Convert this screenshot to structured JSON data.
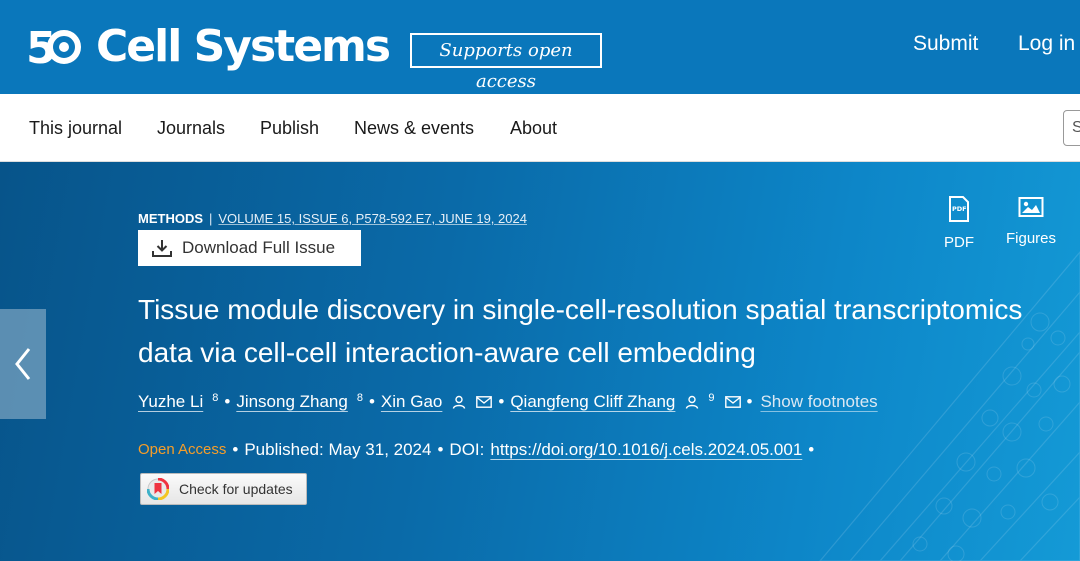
{
  "header": {
    "logo_text": "Cell Systems",
    "badge": "Supports open access",
    "submit_label": "Submit",
    "login_label": "Log in"
  },
  "nav": {
    "items": [
      "This journal",
      "Journals",
      "Publish",
      "News & events",
      "About"
    ],
    "search_placeholder": "S"
  },
  "article": {
    "type": "METHODS",
    "citation": "VOLUME 15, ISSUE 6, P578-592.E7, JUNE 19, 2024",
    "download_label": "Download Full Issue",
    "tools": [
      {
        "label": "PDF",
        "icon": "pdf-icon"
      },
      {
        "label": "Figures",
        "icon": "image-icon"
      }
    ],
    "title": "Tissue module discovery in single-cell-resolution spatial transcriptomics data via cell-cell interaction-aware cell embedding",
    "authors": [
      {
        "name": "Yuzhe Li",
        "sup": "8"
      },
      {
        "name": "Jinsong Zhang",
        "sup": "8"
      },
      {
        "name": "Xin Gao"
      },
      {
        "name": "Qiangfeng Cliff Zhang",
        "sup": "9"
      }
    ],
    "show_footnotes": "Show footnotes",
    "open_access": "Open Access",
    "published": "Published: May 31, 2024",
    "doi_label": "DOI:",
    "doi_url": "https://doi.org/10.1016/j.cels.2024.05.001",
    "check_updates": "Check for updates"
  },
  "colors": {
    "brand_blue": "#0a77bb",
    "open_access_orange": "#f59d2a"
  }
}
